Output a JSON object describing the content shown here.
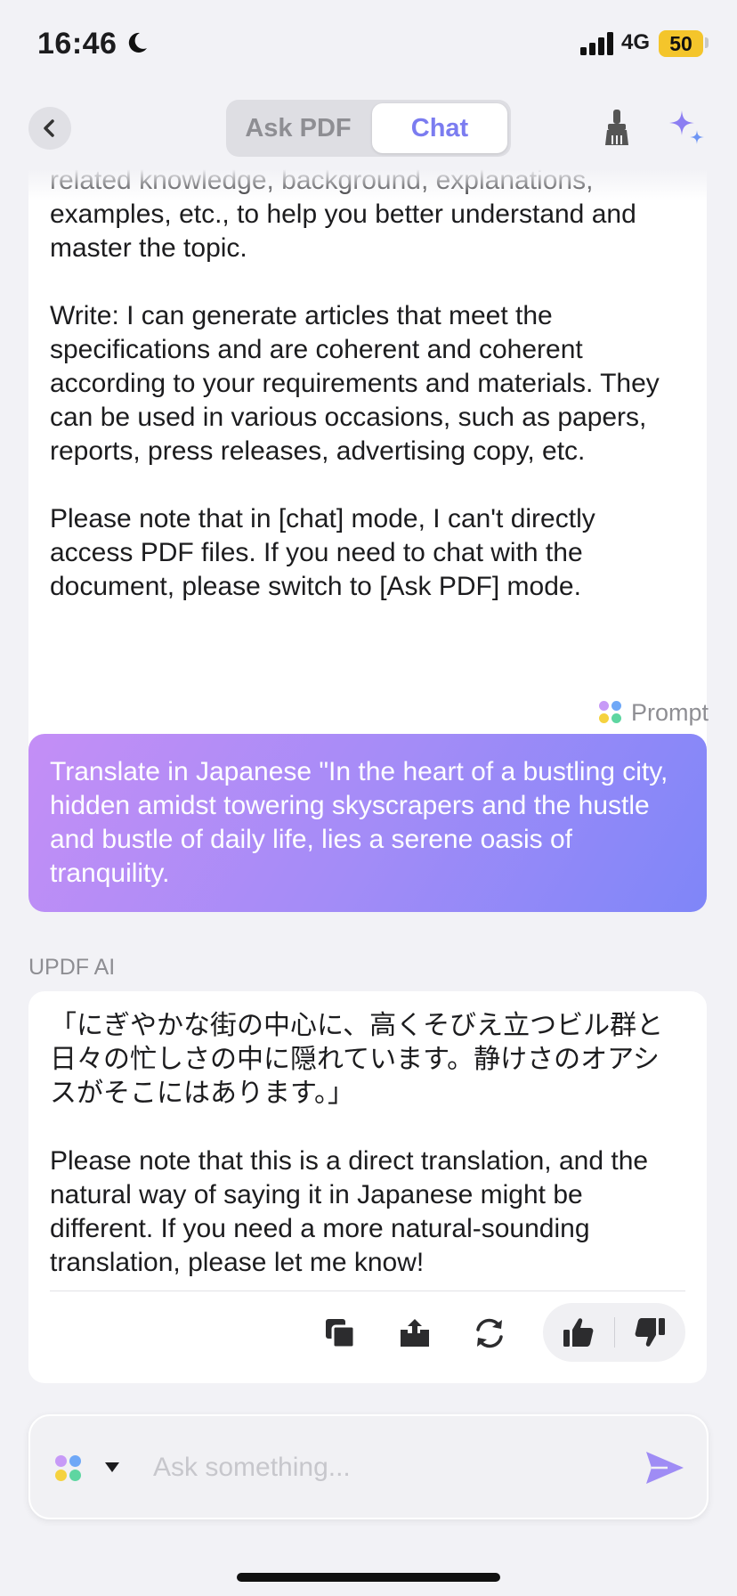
{
  "status_bar": {
    "time": "16:46",
    "network": "4G",
    "battery": "50"
  },
  "header": {
    "tabs": [
      {
        "label": "Ask PDF",
        "active": false
      },
      {
        "label": "Chat",
        "active": true
      }
    ]
  },
  "messages": {
    "previous_response": "related knowledge, background, explanations, examples, etc., to help you better understand and master the topic.\n\nWrite: I can generate articles that meet the specifications and are coherent and coherent according to your requirements and materials. They can be used in various occasions, such as papers, reports, press releases, advertising copy, etc.\n\nPlease note that in [chat] mode, I can't directly access PDF files. If you need to chat with the document, please switch to [Ask PDF] mode.",
    "prompt_label": "Prompt",
    "user_message": "Translate in Japanese \"In the heart of a bustling city, hidden amidst towering skyscrapers and the hustle and bustle of daily life, lies a serene oasis of tranquility.",
    "ai_label": "UPDF AI",
    "ai_response": "「にぎやかな街の中心に、高くそびえ立つビル群と日々の忙しさの中に隠れています。静けさのオアシスがそこにはあります。」\n\nPlease note that this is a direct translation, and the natural way of saying it in Japanese might be different. If you need a more natural-sounding translation, please let me know!"
  },
  "input": {
    "placeholder": "Ask something..."
  },
  "icons": [
    "moon-icon",
    "signal-icon",
    "back-icon",
    "broom-icon",
    "sparkle-icon",
    "copy-icon",
    "share-icon",
    "regenerate-icon",
    "thumbs-up-icon",
    "thumbs-down-icon",
    "prompt-dots-icon",
    "dropdown-caret-icon",
    "send-icon"
  ],
  "colors": {
    "accent": "#7b7cf0",
    "user_bubble_start": "#c48ef6",
    "user_bubble_end": "#7f86f8",
    "battery": "#f4c52b"
  }
}
